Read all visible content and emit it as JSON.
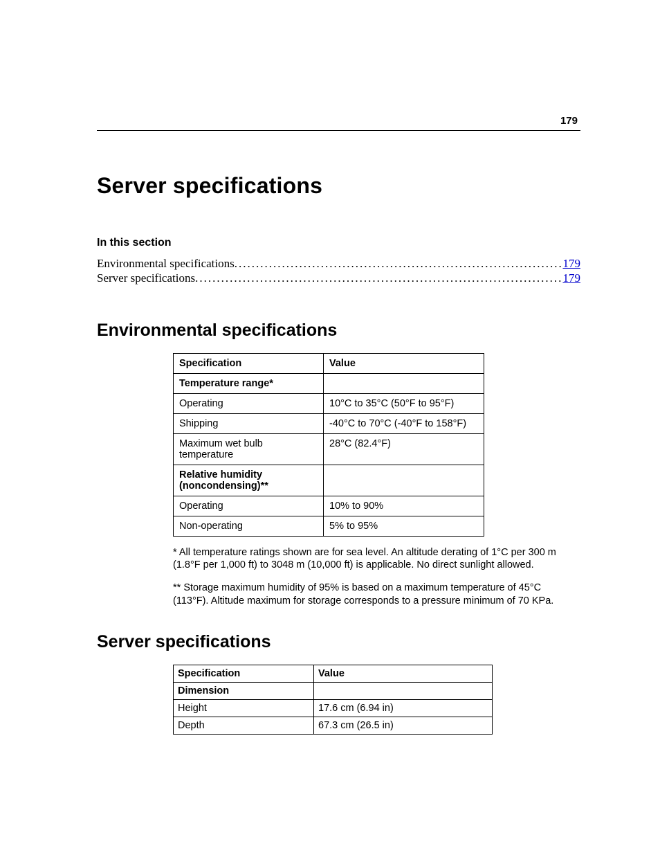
{
  "pageNumber": "179",
  "title": "Server specifications",
  "sectionLabel": "In this section",
  "toc": [
    {
      "label": "Environmental specifications ",
      "page": "179"
    },
    {
      "label": "Server specifications",
      "page": "179"
    }
  ],
  "env": {
    "heading": "Environmental specifications",
    "headers": {
      "spec": "Specification",
      "value": "Value"
    },
    "rows": [
      {
        "spec": "Temperature range*",
        "value": "",
        "bold": true
      },
      {
        "spec": "Operating",
        "value": "10°C  to 35°C (50°F to 95°F)"
      },
      {
        "spec": "Shipping",
        "value": "-40°C  to 70°C (-40°F to 158°F)"
      },
      {
        "spec": "Maximum wet bulb temperature",
        "value": "28°C (82.4°F)"
      },
      {
        "spec": "Relative humidity (noncondensing)**",
        "value": "",
        "bold": true
      },
      {
        "spec": "Operating",
        "value": "10% to 90%"
      },
      {
        "spec": "Non-operating",
        "value": "5% to 95%"
      }
    ],
    "footnote1": "* All temperature ratings shown are for sea level. An altitude derating of 1°C per 300 m (1.8°F per 1,000 ft) to 3048 m (10,000 ft) is applicable. No direct sunlight allowed.",
    "footnote2": "** Storage maximum humidity of 95% is based on a maximum temperature of 45°C (113°F). Altitude maximum for storage corresponds to a pressure minimum of 70 KPa."
  },
  "srv": {
    "heading": "Server specifications",
    "headers": {
      "spec": "Specification",
      "value": "Value"
    },
    "rows": [
      {
        "spec": "Dimension",
        "value": "",
        "bold": true
      },
      {
        "spec": "Height",
        "value": "17.6 cm (6.94 in)"
      },
      {
        "spec": "Depth",
        "value": "67.3 cm (26.5 in)"
      }
    ]
  }
}
